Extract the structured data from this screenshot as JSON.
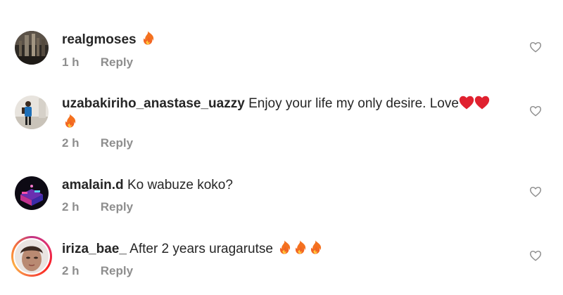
{
  "comments": [
    {
      "username": "realgmoses",
      "text": "🔥",
      "time": "1 h",
      "reply_label": "Reply"
    },
    {
      "username": "uzabakiriho_anastase_uazzy",
      "text": "Enjoy your life my only desire. Love❤️❤️",
      "text_cont": "🔥",
      "time": "2 h",
      "reply_label": "Reply"
    },
    {
      "username": "amalain.d",
      "text": "Ko wabuze koko?",
      "time": "2 h",
      "reply_label": "Reply"
    },
    {
      "username": "iriza_bae_",
      "text": "After 2 years uragarutse 🔥🔥🔥",
      "time": "2 h",
      "reply_label": "Reply"
    }
  ],
  "icons": {
    "like": "heart-outline-icon",
    "fire": "fire-emoji",
    "love": "red-heart-emoji"
  },
  "colors": {
    "text": "#262626",
    "secondary": "#8e8e8e",
    "story_ring": "#e1306c"
  }
}
